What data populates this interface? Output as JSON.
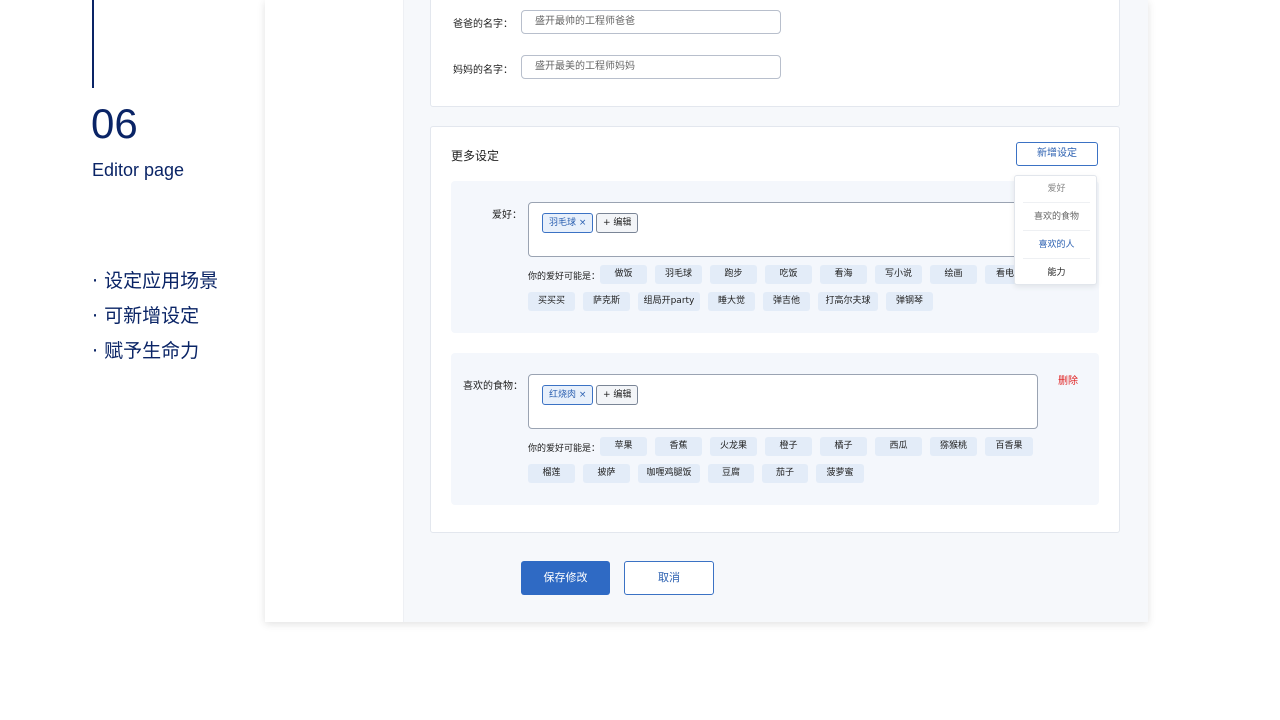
{
  "intro": {
    "number": "06",
    "subtitle": "Editor page",
    "bullets": [
      "· 设定应用场景",
      "· 可新增设定",
      "· 赋予生命力"
    ]
  },
  "parents": {
    "dad_label": "爸爸的名字：",
    "dad_value": "盛开最帅的工程师爸爸",
    "mom_label": "妈妈的名字：",
    "mom_value": "盛开最美的工程师妈妈"
  },
  "more": {
    "title": "更多设定",
    "add_button": "新增设定",
    "menu": [
      "爱好",
      "喜欢的食物",
      "喜欢的人",
      "能力"
    ],
    "hobby": {
      "label": "爱好：",
      "tag": "羽毛球",
      "edit": "+ 编辑",
      "hint": "你的爱好可能是：",
      "chips": [
        "做饭",
        "羽毛球",
        "跑步",
        "吃饭",
        "看海",
        "写小说",
        "绘画",
        "看电",
        "买买买",
        "萨克斯",
        "组局开party",
        "睡大觉",
        "弹吉他",
        "打高尔夫球",
        "弹钢琴"
      ]
    },
    "food": {
      "label": "喜欢的食物：",
      "tag": "红烧肉",
      "edit": "+ 编辑",
      "hint": "你的爱好可能是：",
      "delete": "删除",
      "chips": [
        "苹果",
        "香蕉",
        "火龙果",
        "橙子",
        "橘子",
        "西瓜",
        "猕猴桃",
        "百香果",
        "榴莲",
        "披萨",
        "咖喱鸡腿饭",
        "豆腐",
        "茄子",
        "菠萝蜜"
      ]
    }
  },
  "actions": {
    "save": "保存修改",
    "cancel": "取消"
  },
  "colors": {
    "primary": "#2f6ac4",
    "navy": "#0a2466",
    "danger": "#e02020",
    "chip_bg": "#e3ecf8"
  }
}
